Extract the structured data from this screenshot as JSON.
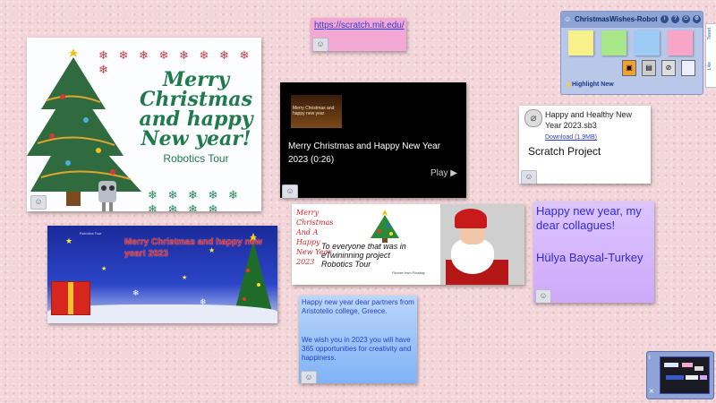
{
  "board": {
    "title": "ChristmasWishes-Robotics",
    "highlight_new": "Highlight New",
    "side_tabs": [
      "Tweet",
      "Like"
    ]
  },
  "cards": {
    "xmas1": {
      "greeting": "Merry Christmas and happy New year!",
      "subtitle": "Robotics Tour",
      "snowflakes": "❄ ❄ ❄ ❄ ❄ ❄ ❄ ❄ ❄"
    },
    "link": {
      "url": "https://scratch.mit.edu/"
    },
    "video": {
      "title": "Merry Christmas and Happy New Year 2023 (0:26)",
      "play_label": "Play ▶",
      "thumb_text": "Merry Christmas and happy new year"
    },
    "file": {
      "name": "Happy and Healthy New Year 2023.sb3",
      "download": "Download (1.9MB)",
      "kind": "Scratch Project"
    },
    "blue": {
      "headline": "Merry Christmas and happy new year! 2023",
      "small": "Robotics Tour"
    },
    "twin": {
      "left_text": "Merry Christmas And A Happy New Year 2023",
      "body": "To everyone that was in eTwininning  project  Robotics Tour",
      "credit": "Picture from Pixabay"
    },
    "lavender": {
      "line1": "Happy new year, my dear collagues!",
      "line2": "Hülya Baysal-Turkey"
    },
    "message": {
      "para1": "Happy new year dear partners from Aristotelio college, Greece.",
      "para2": "We wish you in 2023 you will have 365 opportunities for creativity and happiness."
    }
  },
  "colors": {
    "background": "#f3d6da",
    "swatch_yellow": "#f8f08a",
    "swatch_green": "#a8e88a",
    "swatch_blue": "#9ccbf6",
    "swatch_pink": "#f7a6c8"
  }
}
